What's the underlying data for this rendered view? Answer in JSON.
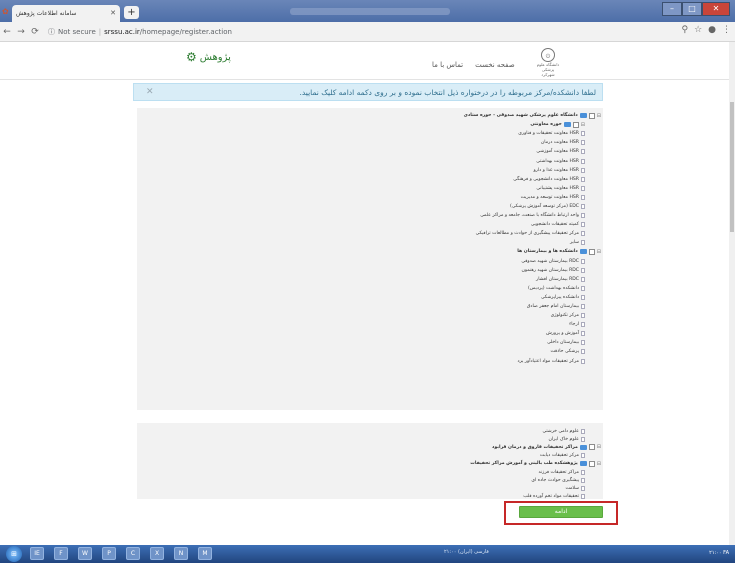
{
  "browser": {
    "tab_title": "سامانه اطلاعات پژوهش",
    "tab_close": "✕",
    "new_tab": "+",
    "security": "Not secure",
    "url_host": "srssu.ac.ir",
    "url_path": "/homepage/register.action",
    "nav": {
      "back": "←",
      "forward": "→",
      "reload": "⟳",
      "info": "ⓘ"
    },
    "tools": {
      "zoom": "⚲",
      "star": "☆",
      "account": "●",
      "menu": "⋮"
    },
    "window": {
      "minimize": "–",
      "maximize": "□",
      "close": "✕"
    }
  },
  "header": {
    "logo_text": "پژوهش",
    "logo_icon": "gear-icon",
    "nav_home": "صفحه نخست",
    "nav_contact": "تماس با ما",
    "seal_glyph": "۞",
    "seal_caption": "دانشگاه علوم پزشکی",
    "seal_caption2": "شهرکرد"
  },
  "notice": {
    "text": "لطفا دانشکده/مرکز مربوطه را در درختواره ذیل انتخاب نموده و بر روی دکمه ادامه کلیک نمایید.",
    "close": "✕"
  },
  "tree": [
    {
      "level": 0,
      "type": "root",
      "label": "دانشگاه علوم پزشکی شهید صدوقی - حوزه ستادی"
    },
    {
      "level": 1,
      "type": "folder",
      "label": "حوزه معاونتی"
    },
    {
      "level": 1,
      "type": "leaf",
      "label": "HSR معاونت تحقیقات و فناوری"
    },
    {
      "level": 1,
      "type": "leaf",
      "label": "HSR معاونت درمان"
    },
    {
      "level": 1,
      "type": "leaf",
      "label": "HSR معاونت آموزشی"
    },
    {
      "level": 1,
      "type": "leaf",
      "label": "HSR معاونت بهداشتی"
    },
    {
      "level": 1,
      "type": "leaf",
      "label": "HSR معاونت غذا و دارو"
    },
    {
      "level": 1,
      "type": "leaf",
      "label": "HSR معاونت دانشجویی و فرهنگی"
    },
    {
      "level": 1,
      "type": "leaf",
      "label": "HSR معاونت پشتیبانی"
    },
    {
      "level": 1,
      "type": "leaf",
      "label": "HSR معاونت توسعه و مدیریت"
    },
    {
      "level": 1,
      "type": "leaf",
      "label": "EDC (مرکز توسعه آموزش پزشکی)"
    },
    {
      "level": 1,
      "type": "leaf",
      "label": "واحد ارتباط دانشگاه با صنعت، جامعه و مراکز علمی"
    },
    {
      "level": 1,
      "type": "leaf",
      "label": "کمیته تحقیقات دانشجویی"
    },
    {
      "level": 1,
      "type": "leaf",
      "label": "مرکز تحقیقات پیشگیری از حوادث و مطالعات ترافیکی"
    },
    {
      "level": 1,
      "type": "leaf",
      "label": "سایر"
    },
    {
      "level": 0,
      "type": "root",
      "label": "دانشکده ها و بیمارستان ها"
    },
    {
      "level": 1,
      "type": "leaf",
      "label": "RDC بیمارستان شهید صدوقی"
    },
    {
      "level": 1,
      "type": "leaf",
      "label": "RDC بیمارستان شهید رهنمون"
    },
    {
      "level": 1,
      "type": "leaf",
      "label": "RDC بیمارستان افشار"
    },
    {
      "level": 1,
      "type": "leaf",
      "label": "دانشکده بهداشت (پردیس)"
    },
    {
      "level": 1,
      "type": "leaf",
      "label": "دانشکده پیراپزشکی"
    },
    {
      "level": 1,
      "type": "leaf",
      "label": "بیمارستان امام جعفر صادق"
    },
    {
      "level": 1,
      "type": "leaf",
      "label": "مرکز تکنولوژی"
    },
    {
      "level": 1,
      "type": "leaf",
      "label": "ارجاء"
    },
    {
      "level": 1,
      "type": "leaf",
      "label": "آموزش و پرورش"
    },
    {
      "level": 1,
      "type": "leaf",
      "label": "بیمارستان داخلی"
    },
    {
      "level": 1,
      "type": "leaf",
      "label": "پزشکی حاذقت"
    },
    {
      "level": 1,
      "type": "leaf",
      "label": "مرکز تحقیقات مواد اعتیادآور یزد"
    }
  ],
  "tree2": [
    {
      "level": 1,
      "type": "leaf",
      "label": "علوم دامی خرشتی"
    },
    {
      "level": 1,
      "type": "leaf",
      "label": "علوم خاک ایران"
    },
    {
      "level": 0,
      "type": "root",
      "label": "مراکز تحقیقات فاروق و درمان فرابود"
    },
    {
      "level": 1,
      "type": "leaf",
      "label": "مرکز تحقیقات دیابت"
    },
    {
      "level": 0,
      "type": "root",
      "label": "پژوهشکده طب بالینی و آموزش مراکز تحقیقات"
    },
    {
      "level": 1,
      "type": "leaf",
      "label": "مراکز تحقیقات فرزند"
    },
    {
      "level": 1,
      "type": "leaf",
      "label": "پیشگیری حوادث جاده ای"
    },
    {
      "level": 1,
      "type": "leaf",
      "label": "سلامت"
    },
    {
      "level": 1,
      "type": "leaf",
      "label": "تحقیقات مواد تخم آورده قلب"
    }
  ],
  "actions": {
    "continue_label": "ادامه"
  },
  "taskbar": {
    "start": "⊞",
    "caption": "فارسی (ایران) ۲۱:۰۰",
    "tray": "۲۱:۰۰ FA",
    "icons": [
      "IE",
      "F",
      "W",
      "P",
      "C",
      "X",
      "N",
      "M"
    ]
  },
  "colors": {
    "notice_bg": "#d9edf7",
    "notice_text": "#31708f",
    "button_green": "#6abf4b",
    "highlight_red": "#c62828",
    "folder_blue": "#4a90d9"
  }
}
